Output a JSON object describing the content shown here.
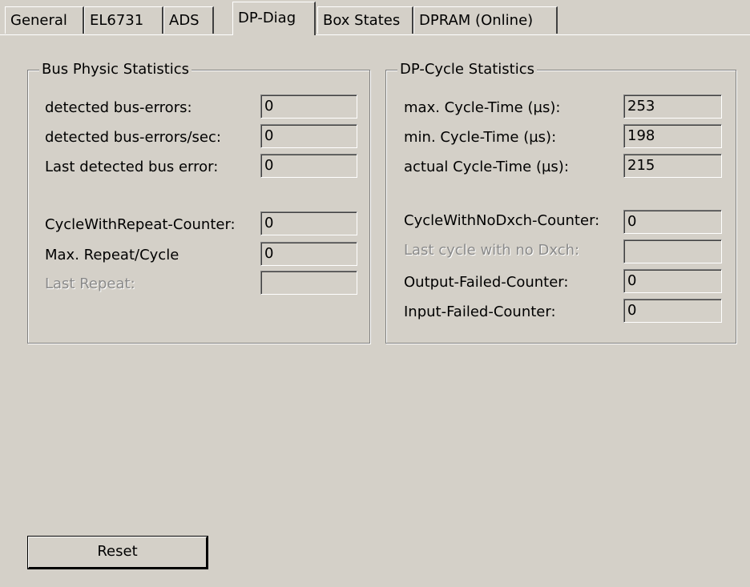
{
  "tabs": [
    {
      "label": "General"
    },
    {
      "label": "EL6731"
    },
    {
      "label": "ADS"
    },
    {
      "label": "DP-Diag",
      "active": true
    },
    {
      "label": "Box States"
    },
    {
      "label": "DPRAM (Online)"
    }
  ],
  "bus_physic": {
    "title": "Bus Physic Statistics",
    "rows": [
      {
        "label": "detected bus-errors:",
        "value": "0"
      },
      {
        "label": "detected bus-errors/sec:",
        "value": "0"
      },
      {
        "label": "Last detected bus error:",
        "value": "0"
      },
      {
        "label": "CycleWithRepeat-Counter:",
        "value": "0"
      },
      {
        "label": "Max. Repeat/Cycle",
        "value": "0"
      },
      {
        "label": "Last Repeat:",
        "value": "",
        "disabled": true
      }
    ]
  },
  "dp_cycle": {
    "title": "DP-Cycle Statistics",
    "rows": [
      {
        "label": "max. Cycle-Time (µs):",
        "value": "253"
      },
      {
        "label": "min. Cycle-Time (µs):",
        "value": "198"
      },
      {
        "label": "actual Cycle-Time (µs):",
        "value": "215"
      },
      {
        "label": "CycleWithNoDxch-Counter:",
        "value": "0"
      },
      {
        "label": "Last cycle with no Dxch:",
        "value": "",
        "disabled": true
      },
      {
        "label": "Output-Failed-Counter:",
        "value": "0"
      },
      {
        "label": "Input-Failed-Counter:",
        "value": "0"
      }
    ]
  },
  "reset_button": {
    "label": "Reset"
  }
}
